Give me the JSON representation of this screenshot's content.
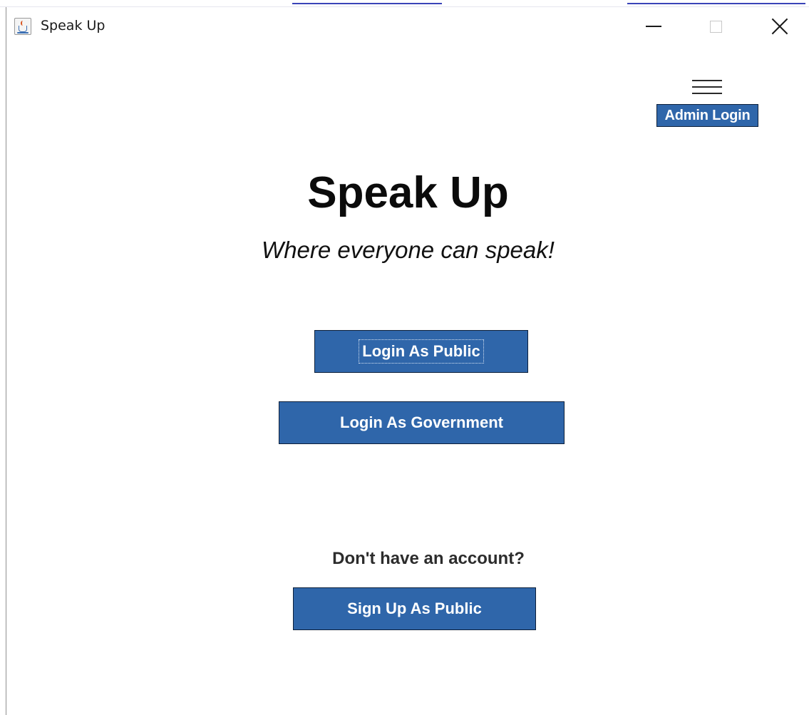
{
  "window": {
    "title": "Speak Up",
    "controls": [
      "minimize",
      "maximize",
      "close"
    ]
  },
  "menu": {
    "icon": "hamburger-menu-icon",
    "admin_login_label": "Admin Login"
  },
  "hero": {
    "heading": "Speak Up",
    "tagline": "Where everyone can speak!"
  },
  "actions": {
    "login_public_label": "Login As Public",
    "login_government_label": "Login As Government"
  },
  "signup": {
    "prompt": "Don't have an account?",
    "signup_public_label": "Sign Up As Public"
  },
  "colors": {
    "button_bg": "#2f66aa",
    "button_text": "#ffffff",
    "background": "#ffffff"
  }
}
